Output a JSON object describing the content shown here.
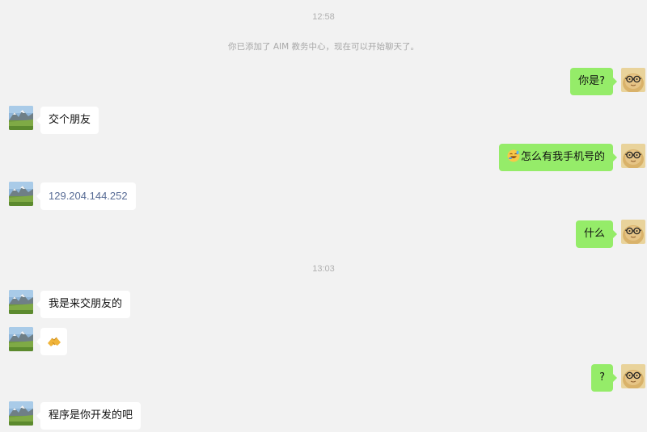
{
  "timestamps": [
    "12:58",
    "13:03"
  ],
  "system_notice": "你已添加了 AIM 教务中心，现在可以开始聊天了。",
  "messages": [
    {
      "side": "out",
      "text": "你是?"
    },
    {
      "side": "in",
      "text": "交个朋友"
    },
    {
      "side": "out",
      "text": "怎么有我手机号的",
      "emoji": "sweat-laugh-emoji"
    },
    {
      "side": "in",
      "text": "129.204.144.252",
      "link": true
    },
    {
      "side": "out",
      "text": "什么"
    },
    {
      "side": "in",
      "text": "我是来交朋友的"
    },
    {
      "side": "in",
      "emoji": "handshake-emoji"
    },
    {
      "side": "out",
      "text": "?"
    },
    {
      "side": "in",
      "text": "程序是你开发的吧"
    }
  ],
  "colors": {
    "background": "#f2f2f2",
    "outgoing_bubble": "#95ec69",
    "incoming_bubble": "#ffffff",
    "link": "#576b95"
  },
  "avatars": {
    "contact": "mountain-landscape-avatar",
    "self": "glasses-character-avatar"
  }
}
